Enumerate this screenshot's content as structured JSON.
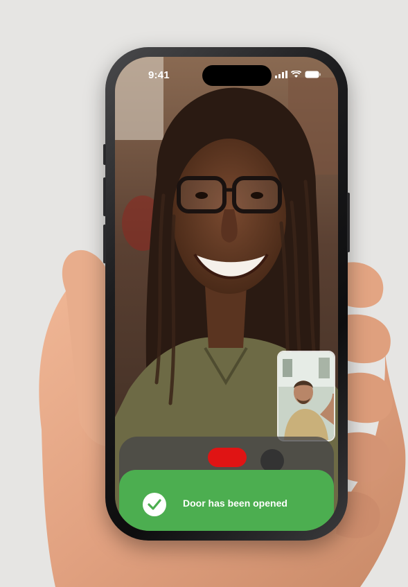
{
  "status_bar": {
    "time": "9:41"
  },
  "call": {
    "end_call_color": "#e01414"
  },
  "toast": {
    "message": "Door has been opened",
    "color": "#4cae50",
    "icon": "checkmark-circle-icon"
  }
}
